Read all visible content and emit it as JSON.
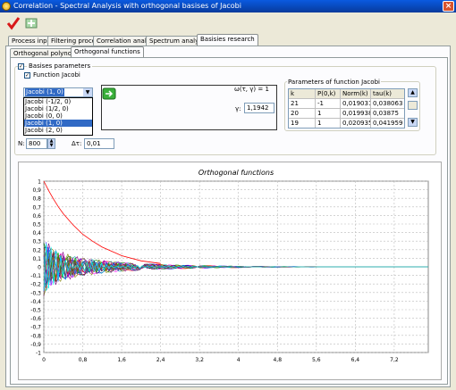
{
  "window": {
    "title": "Correlation - Spectral Analysis with orthogonal basises of Jacobi",
    "close": "×"
  },
  "icons": {
    "app": "app-logo-icon",
    "close": "close-icon",
    "check": "checkmark-icon",
    "cancel": "cancel-icon",
    "calc": "calculate-icon"
  },
  "tabs": [
    "Process input",
    "Filtering process",
    "Correlation analisis",
    "Spectrum analysis",
    "Basisies research"
  ],
  "subtabs": [
    "Orthogonal polynomial",
    "Orthogonal functions"
  ],
  "params": {
    "basises_label": "Basises parameters",
    "function_label": "Function Jacobi",
    "combo_value": "Jacobi (1, 0)",
    "combo_options": [
      "Jacobi (-1/2, 0)",
      "Jacobi (1/2, 0)",
      "Jacobi (0, 0)",
      "Jacobi (1, 0)",
      "Jacobi (2, 0)"
    ],
    "combo_selected_index": 3,
    "omega_text": "ω(τ, γ) = 1",
    "gamma_label": "γ:",
    "gamma_value": "1,1942",
    "n_label": "N:",
    "n_value": "800",
    "dt_label": "Δτ:",
    "dt_value": "0,01"
  },
  "jacobi_table": {
    "title": "Parameters of function Jacobi",
    "columns": [
      "k",
      "P(0,k)",
      "Norm(k)",
      "tau(k)"
    ],
    "rows": [
      [
        "21",
        "-1",
        "0,019031",
        "0,038063"
      ],
      [
        "20",
        "1",
        "0,019938",
        "0,03875"
      ],
      [
        "19",
        "1",
        "0,020935",
        "0,041959"
      ]
    ]
  },
  "chart_data": {
    "type": "line",
    "title": "Orthogonal functions",
    "xlabel": "",
    "ylabel": "",
    "xlim": [
      0,
      7.9
    ],
    "ylim": [
      -1,
      1
    ],
    "xticks": [
      "0",
      "0,8",
      "1,6",
      "2,4",
      "3,2",
      "4",
      "4,8",
      "5,6",
      "6,4",
      "7,2"
    ],
    "xtick_values": [
      0,
      0.8,
      1.6,
      2.4,
      3.2,
      4,
      4.8,
      5.6,
      6.4,
      7.2
    ],
    "yticks": [
      "1",
      "0,9",
      "0,8",
      "0,7",
      "0,6",
      "0,5",
      "0,4",
      "0,3",
      "0,2",
      "0,1",
      "0",
      "-0,1",
      "-0,2",
      "-0,3",
      "-0,4",
      "-0,5",
      "-0,6",
      "-0,7",
      "-0,8",
      "-0,9",
      "-1"
    ],
    "grid": true,
    "series_colors": [
      "#ff0000",
      "#0000ff",
      "#008000",
      "#ff00ff",
      "#00aaaa",
      "#808000",
      "#800080",
      "#008080",
      "#ff8000",
      "#000080",
      "#800000",
      "#00c000",
      "#c000c0",
      "#4040ff",
      "#a0a000",
      "#ff4080",
      "#408040",
      "#0080ff",
      "#804000",
      "#606060",
      "#00ffff"
    ],
    "main_series": {
      "x": [
        0,
        0.1,
        0.2,
        0.3,
        0.4,
        0.6,
        0.8,
        1.0,
        1.2,
        1.6,
        2.0,
        2.4
      ],
      "y": [
        1,
        0.89,
        0.79,
        0.7,
        0.62,
        0.49,
        0.38,
        0.3,
        0.23,
        0.13,
        0.07,
        0.04
      ]
    }
  }
}
